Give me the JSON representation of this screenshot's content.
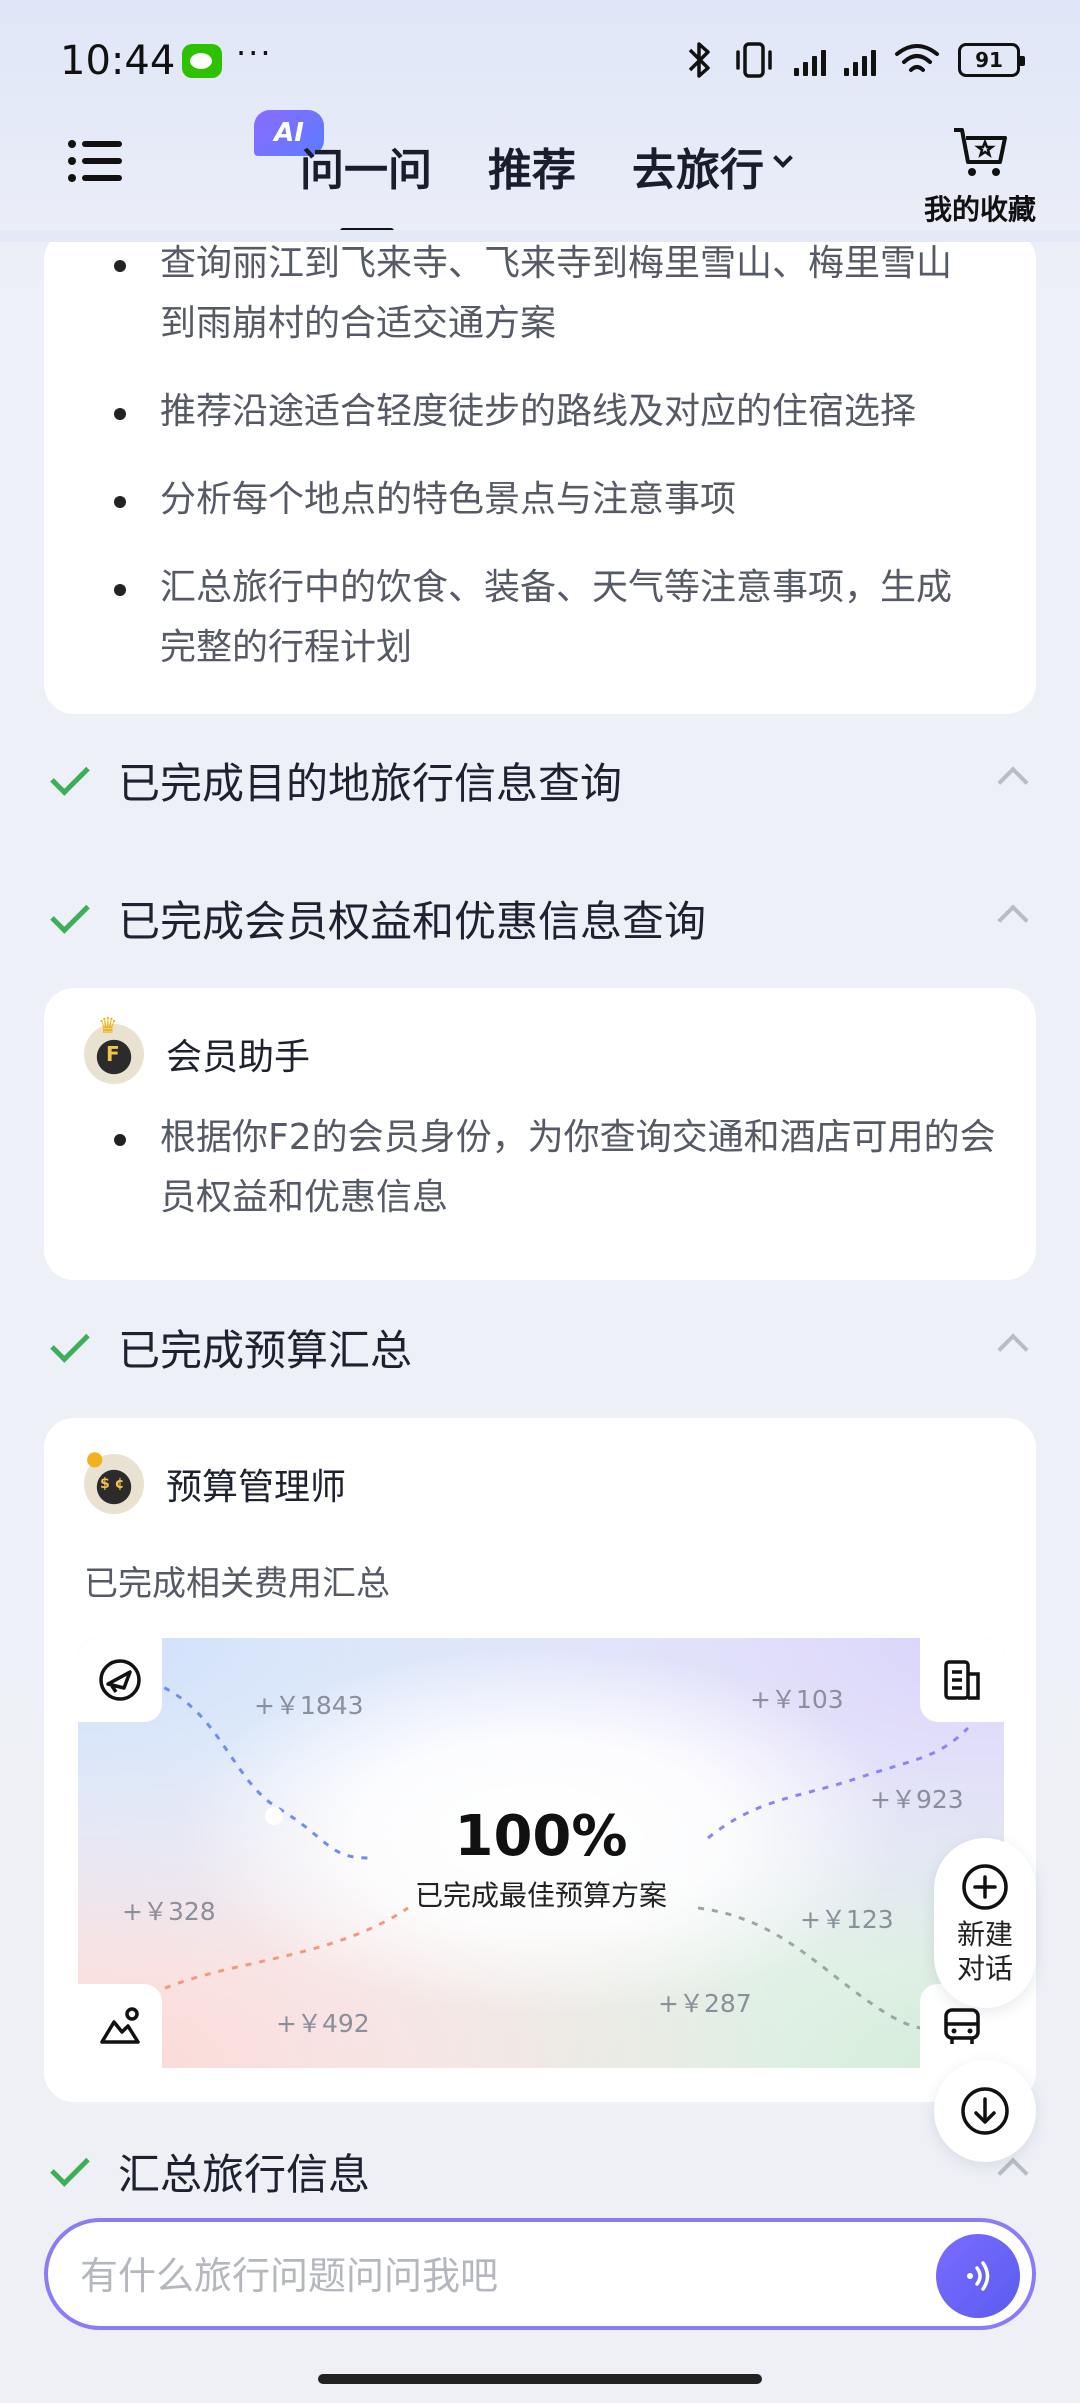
{
  "status_bar": {
    "time": "10:44",
    "more": "···",
    "battery": "91"
  },
  "nav": {
    "ai_badge": "AI",
    "tabs": [
      {
        "label": "问一问",
        "active": true
      },
      {
        "label": "推荐",
        "active": false
      },
      {
        "label": "去旅行",
        "active": false
      }
    ],
    "favorites_label": "我的收藏"
  },
  "plan_card": {
    "items": [
      "查询丽江到飞来寺、飞来寺到梅里雪山、梅里雪山到雨崩村的合适交通方案",
      "推荐沿途适合轻度徒步的路线及对应的住宿选择",
      "分析每个地点的特色景点与注意事项",
      "汇总旅行中的饮食、装备、天气等注意事项，生成完整的行程计划"
    ]
  },
  "steps": [
    {
      "title": "已完成目的地旅行信息查询"
    },
    {
      "title": "已完成会员权益和优惠信息查询"
    },
    {
      "title": "已完成预算汇总"
    },
    {
      "title": "汇总旅行信息"
    }
  ],
  "member_card": {
    "agent_name": "会员助手",
    "items": [
      "根据你F2的会员身份，为你查询交通和酒店可用的会员权益和优惠信息"
    ]
  },
  "budget_card": {
    "agent_name": "预算管理师",
    "subtitle": "已完成相关费用汇总",
    "percent": "100%",
    "percent_label": "已完成最佳预算方案",
    "progress_value": 100,
    "amounts": [
      "+￥1843",
      "+￥103",
      "+￥923",
      "+￥328",
      "+￥123",
      "+￥492",
      "+￥287"
    ]
  },
  "fab": {
    "new_chat_line1": "新建",
    "new_chat_line2": "对话"
  },
  "input": {
    "placeholder": "有什么旅行问题问问我吧"
  },
  "colors": {
    "accent": "#6f63f6",
    "check": "#3fae5a",
    "bg": "#eef0f6"
  }
}
